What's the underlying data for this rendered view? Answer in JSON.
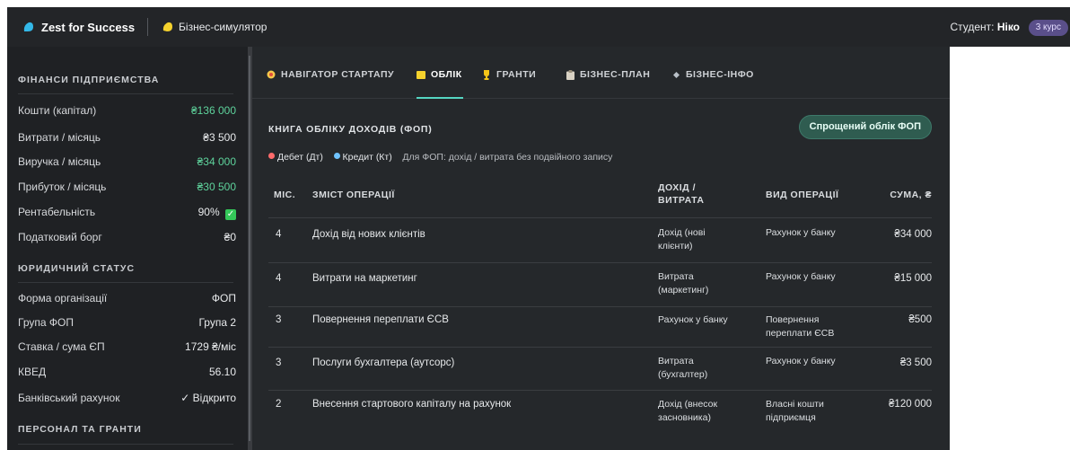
{
  "header": {
    "brand": "Zest for Success",
    "app_name": "Бізнес-симулятор",
    "student_label": "Студент:",
    "student_name": "Ніко",
    "year_badge": "3 курс"
  },
  "sidebar": {
    "finance": {
      "title": "ФІНАНСИ ПІДПРИЄМСТВА",
      "rows": [
        {
          "label": "Кошти (капітал)",
          "value": "₴136 000"
        },
        {
          "label": "Витрати / місяць",
          "value": "₴3 500"
        },
        {
          "label": "Виручка / місяць",
          "value": "₴34 000"
        },
        {
          "label": "Прибуток / місяць",
          "value": "₴30 500"
        },
        {
          "label": "Рентабельність",
          "value": "90%"
        },
        {
          "label": "Податковий борг",
          "value": "₴0"
        }
      ]
    },
    "legal": {
      "title": "ЮРИДИЧНИЙ СТАТУС",
      "rows": [
        {
          "label": "Форма організації",
          "value": "ФОП"
        },
        {
          "label": "Група ФОП",
          "value": "Група 2"
        },
        {
          "label": "Ставка / сума ЄП",
          "value": "1729 ₴/міс"
        },
        {
          "label": "КВЕД",
          "value": "56.10"
        },
        {
          "label": "Банківський рахунок",
          "value": "✓ Відкрито"
        }
      ]
    },
    "staff": {
      "title": "ПЕРСОНАЛ ТА ГРАНТИ"
    }
  },
  "tabs": [
    {
      "label": "НАВІГАТОР СТАРТАПУ",
      "icon": "target-icon"
    },
    {
      "label": "ОБЛІК",
      "icon": "ledger-icon"
    },
    {
      "label": "ГРАНТИ",
      "icon": "trophy-icon"
    },
    {
      "label": "БІЗНЕС-ПЛАН",
      "icon": "clipboard-icon"
    },
    {
      "label": "БІЗНЕС-ІНФО",
      "icon": "info-icon"
    }
  ],
  "ledger": {
    "title": "КНИГА ОБЛІКУ ДОХОДІВ (ФОП)",
    "simplified_button": "Спрощений облік ФОП",
    "legend": {
      "debit": "Дебет (Дт)",
      "credit": "Кредит (Кт)",
      "note": "Для ФОП: дохід / витрата без подвійного запису"
    },
    "columns": {
      "month": "МІС.",
      "content": "ЗМІСТ ОПЕРАЦІЇ",
      "income_line1": "ДОХІД /",
      "income_line2": "ВИТРАТА",
      "type": "ВИД ОПЕРАЦІЇ",
      "amount": "СУМА, ₴"
    },
    "rows": [
      {
        "month": "4",
        "content": "Дохід від нових клієнтів",
        "inc1": "Дохід (нові",
        "inc2": "клієнти)",
        "type1": "Рахунок у банку",
        "type2": "",
        "amount": "₴34 000"
      },
      {
        "month": "4",
        "content": "Витрати на маркетинг",
        "inc1": "Витрата",
        "inc2": "(маркетинг)",
        "type1": "Рахунок у банку",
        "type2": "",
        "amount": "₴15 000"
      },
      {
        "month": "3",
        "content": "Повернення переплати ЄСВ",
        "inc1": "Рахунок у банку",
        "inc2": "",
        "type1": "Повернення",
        "type2": "переплати ЄСВ",
        "amount": "₴500"
      },
      {
        "month": "3",
        "content": "Послуги бухгалтера (аутсорс)",
        "inc1": "Витрата",
        "inc2": "(бухгалтер)",
        "type1": "Рахунок у банку",
        "type2": "",
        "amount": "₴3 500"
      },
      {
        "month": "2",
        "content": "Внесення стартового капіталу на рахунок",
        "inc1": "Дохід (внесок",
        "inc2": "засновника)",
        "type1": "Власні кошти",
        "type2": "підприємця",
        "amount": "₴120 000"
      }
    ]
  },
  "colors": {
    "accent": "#55d6c2",
    "positive": "#5ed39c",
    "debit_dot": "#ff6b6b",
    "credit_dot": "#6fc3ff"
  }
}
